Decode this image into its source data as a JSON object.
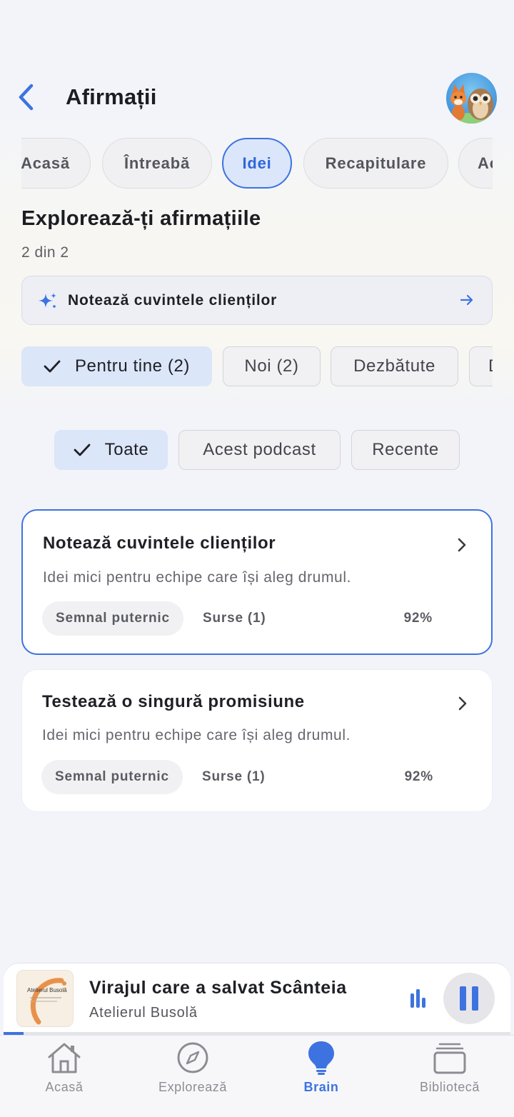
{
  "header": {
    "title": "Afirmații",
    "back_icon": "chevron-left-icon",
    "avatar": "avatar-fox-owl"
  },
  "tabs": [
    {
      "label": "Acasă",
      "active": false
    },
    {
      "label": "Întreabă",
      "active": false
    },
    {
      "label": "Idei",
      "active": true
    },
    {
      "label": "Recapitulare",
      "active": false
    },
    {
      "label": "Ac",
      "active": false
    }
  ],
  "section": {
    "title": "Explorează-ți afirmațiile",
    "count": "2 din 2"
  },
  "suggestion": {
    "icon": "sparkle-icon",
    "label": "Notează cuvintele clienților",
    "arrow_icon": "arrow-right-icon"
  },
  "filters": [
    {
      "label": "Pentru tine (2)",
      "selected": true
    },
    {
      "label": "Noi (2)",
      "selected": false
    },
    {
      "label": "Dezbătute",
      "selected": false
    },
    {
      "label": "D",
      "selected": false
    }
  ],
  "scope_filters": [
    {
      "label": "Toate",
      "selected": true
    },
    {
      "label": "Acest podcast",
      "selected": false
    },
    {
      "label": "Recente",
      "selected": false
    }
  ],
  "cards": [
    {
      "title": "Notează cuvintele clienților",
      "description": "Idei mici pentru echipe care își aleg drumul.",
      "badge": "Semnal puternic",
      "sources": "Surse (1)",
      "score": "92%",
      "highlighted": true
    },
    {
      "title": "Testează o singură promisiune",
      "description": "Idei mici pentru echipe care își aleg drumul.",
      "badge": "Semnal puternic",
      "sources": "Surse (1)",
      "score": "92%",
      "highlighted": false
    }
  ],
  "player": {
    "title": "Virajul care a salvat Scânteia",
    "show": "Atelierul Busolă",
    "art_text": "Atelierul Busolă",
    "progress": 0.04,
    "bars_icon": "audio-bars-icon",
    "pause_icon": "pause-icon"
  },
  "bottom_nav": [
    {
      "label": "Acasă",
      "icon": "home-icon",
      "active": false
    },
    {
      "label": "Explorează",
      "icon": "compass-icon",
      "active": false
    },
    {
      "label": "Brain",
      "icon": "lightbulb-icon",
      "active": true
    },
    {
      "label": "Bibliotecă",
      "icon": "library-icon",
      "active": false
    }
  ],
  "colors": {
    "accent": "#3d73e0",
    "background": "#f3f4f9",
    "chip_selected": "#dbe6f8"
  }
}
